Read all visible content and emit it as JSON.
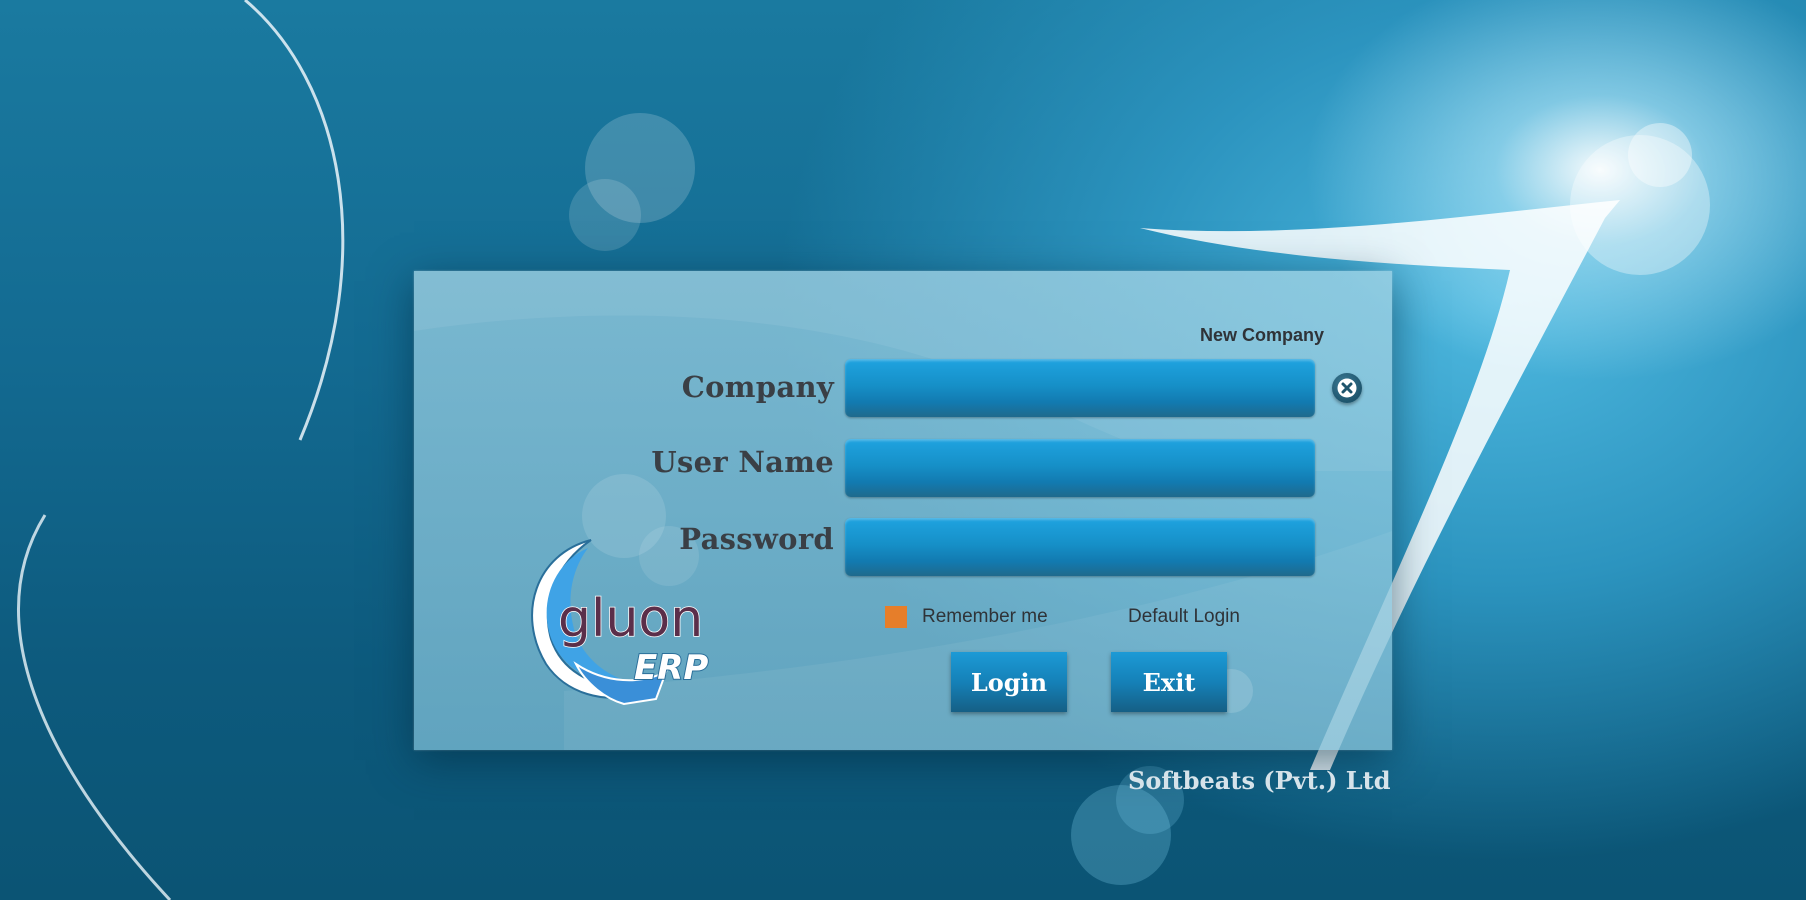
{
  "login": {
    "new_company_label": "New Company",
    "company_label": "Company",
    "username_label": "User Name",
    "password_label": "Password",
    "company_value": "",
    "username_value": "",
    "password_value": "",
    "remember_label": "Remember me",
    "default_login_label": "Default Login",
    "login_button": "Login",
    "exit_button": "Exit"
  },
  "logo": {
    "brand_text": "gluon",
    "product_text": "ERP"
  },
  "footer": {
    "company_name": "Softbeats (Pvt.) Ltd"
  },
  "icons": {
    "clear": "close-icon",
    "remember": "checkbox-icon"
  },
  "colors": {
    "accent_orange": "#e67e2a",
    "field_blue": "#1690c8",
    "label_dark": "#3a3f45"
  }
}
